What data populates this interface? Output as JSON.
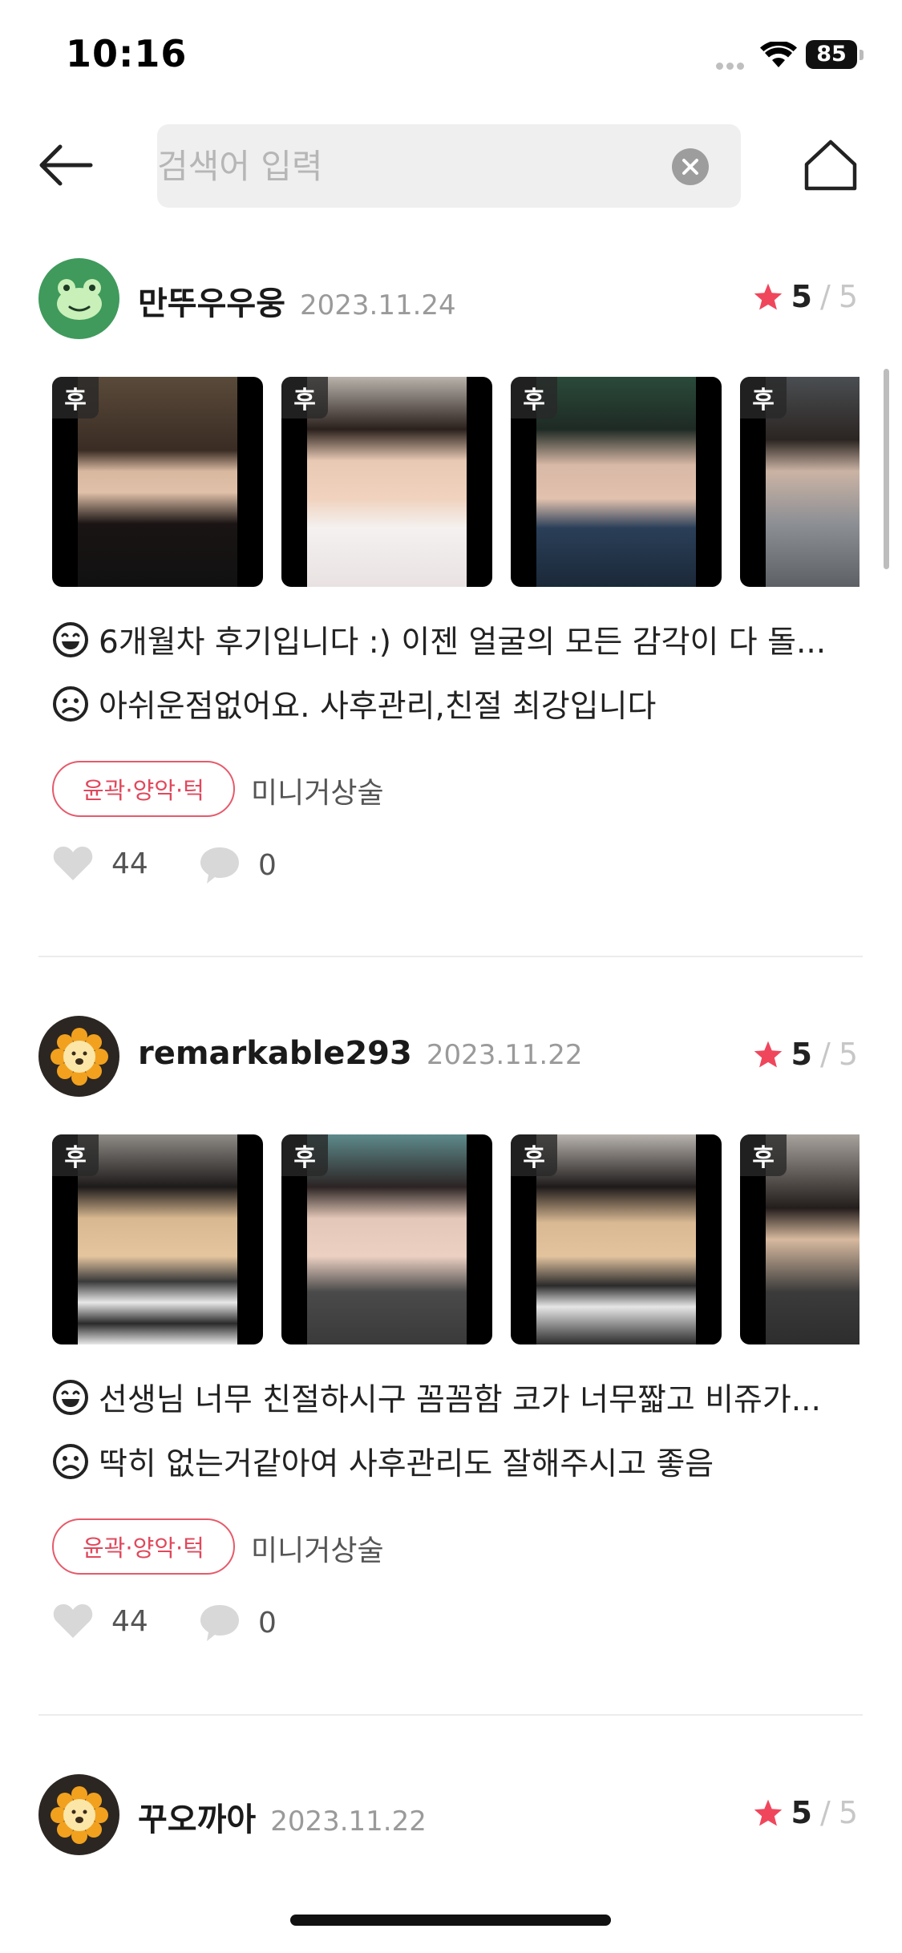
{
  "status_bar": {
    "time": "10:16",
    "battery": "85"
  },
  "header": {
    "search_placeholder": "검색어 입력"
  },
  "reviews": [
    {
      "username": "만뚜우우웅",
      "date": "2023.11.24",
      "rating": "5",
      "rating_max": "5",
      "photo_badge": "후",
      "photo_extra_count": "1",
      "positive": "6개월차 후기입니다 :) 이젠 얼굴의 모든 감각이 다 돌...",
      "negative": "아쉬운점없어요. 사후관리,친절 최강입니다",
      "tag": "윤곽·양악·턱",
      "procedure": "미니거상술",
      "likes": "44",
      "comments": "0"
    },
    {
      "username": "remarkable293",
      "date": "2023.11.22",
      "rating": "5",
      "rating_max": "5",
      "photo_badge": "후",
      "photo_extra_count": "1",
      "positive": "선생님 너무 친절하시구 꼼꼼함 코가 너무짧고 비쥬가...",
      "negative": "딱히 없는거같아여 사후관리도 잘해주시고 좋음",
      "tag": "윤곽·양악·턱",
      "procedure": "미니거상술",
      "likes": "44",
      "comments": "0"
    },
    {
      "username": "꾸오까아",
      "date": "2023.11.22",
      "rating": "5",
      "rating_max": "5"
    }
  ],
  "colors": {
    "accent": "#e0485c",
    "star": "#f0465c",
    "avatar_green": "#3f9a5c",
    "avatar_dark": "#2c2623"
  }
}
